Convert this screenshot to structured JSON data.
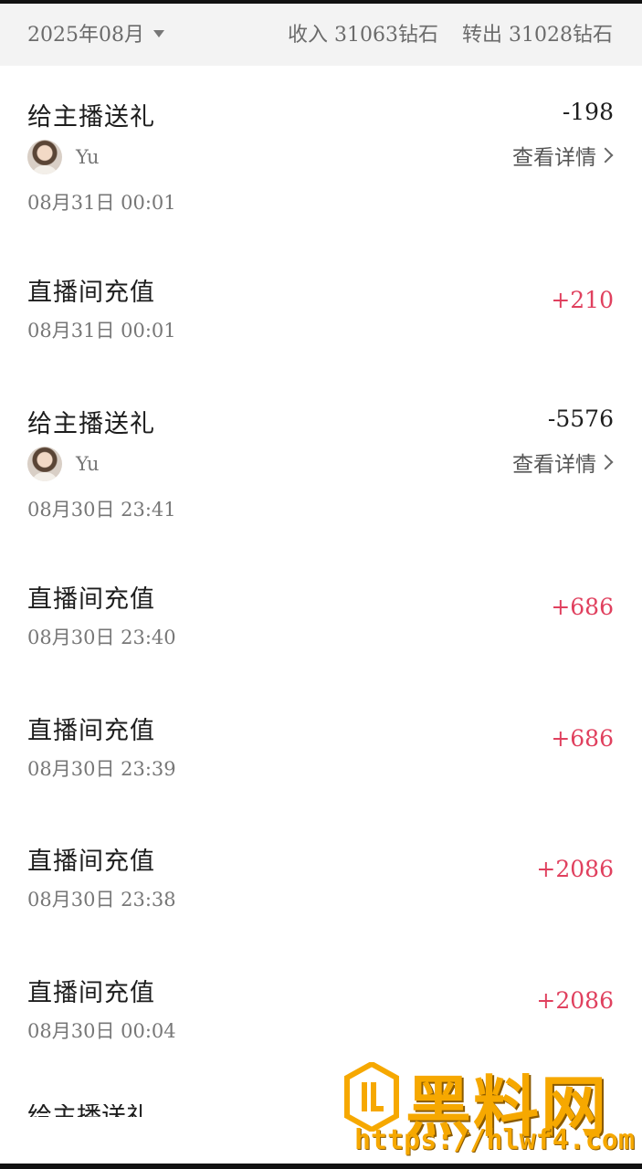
{
  "summary": {
    "month": "2025年08月",
    "income": "收入 31063钻石",
    "outgoing": "转出 31028钻石"
  },
  "transactions": [
    {
      "title": "给主播送礼",
      "amount": "-198",
      "type": "minus",
      "user": "Yu",
      "details": "查看详情",
      "date": "08月31日 00:01"
    },
    {
      "title": "直播间充值",
      "amount": "+210",
      "type": "plus",
      "date": "08月31日 00:01"
    },
    {
      "title": "给主播送礼",
      "amount": "-5576",
      "type": "minus",
      "user": "Yu",
      "details": "查看详情",
      "date": "08月30日 23:41"
    },
    {
      "title": "直播间充值",
      "amount": "+686",
      "type": "plus",
      "date": "08月30日 23:40"
    },
    {
      "title": "直播间充值",
      "amount": "+686",
      "type": "plus",
      "date": "08月30日 23:39"
    },
    {
      "title": "直播间充值",
      "amount": "+2086",
      "type": "plus",
      "date": "08月30日 23:38"
    },
    {
      "title": "直播间充值",
      "amount": "+2086",
      "type": "plus",
      "date": "08月30日 00:04"
    },
    {
      "title": "给主播送礼"
    }
  ],
  "watermark": {
    "text": "黑料网",
    "url": "https://hlwf4.com"
  },
  "colors": {
    "plus": "#e0405e",
    "minus": "#1d1d1d",
    "watermark": "#f6a800"
  },
  "icons": {
    "month_dropdown": "caret-down-icon",
    "details_arrow": "chevron-right-icon"
  }
}
